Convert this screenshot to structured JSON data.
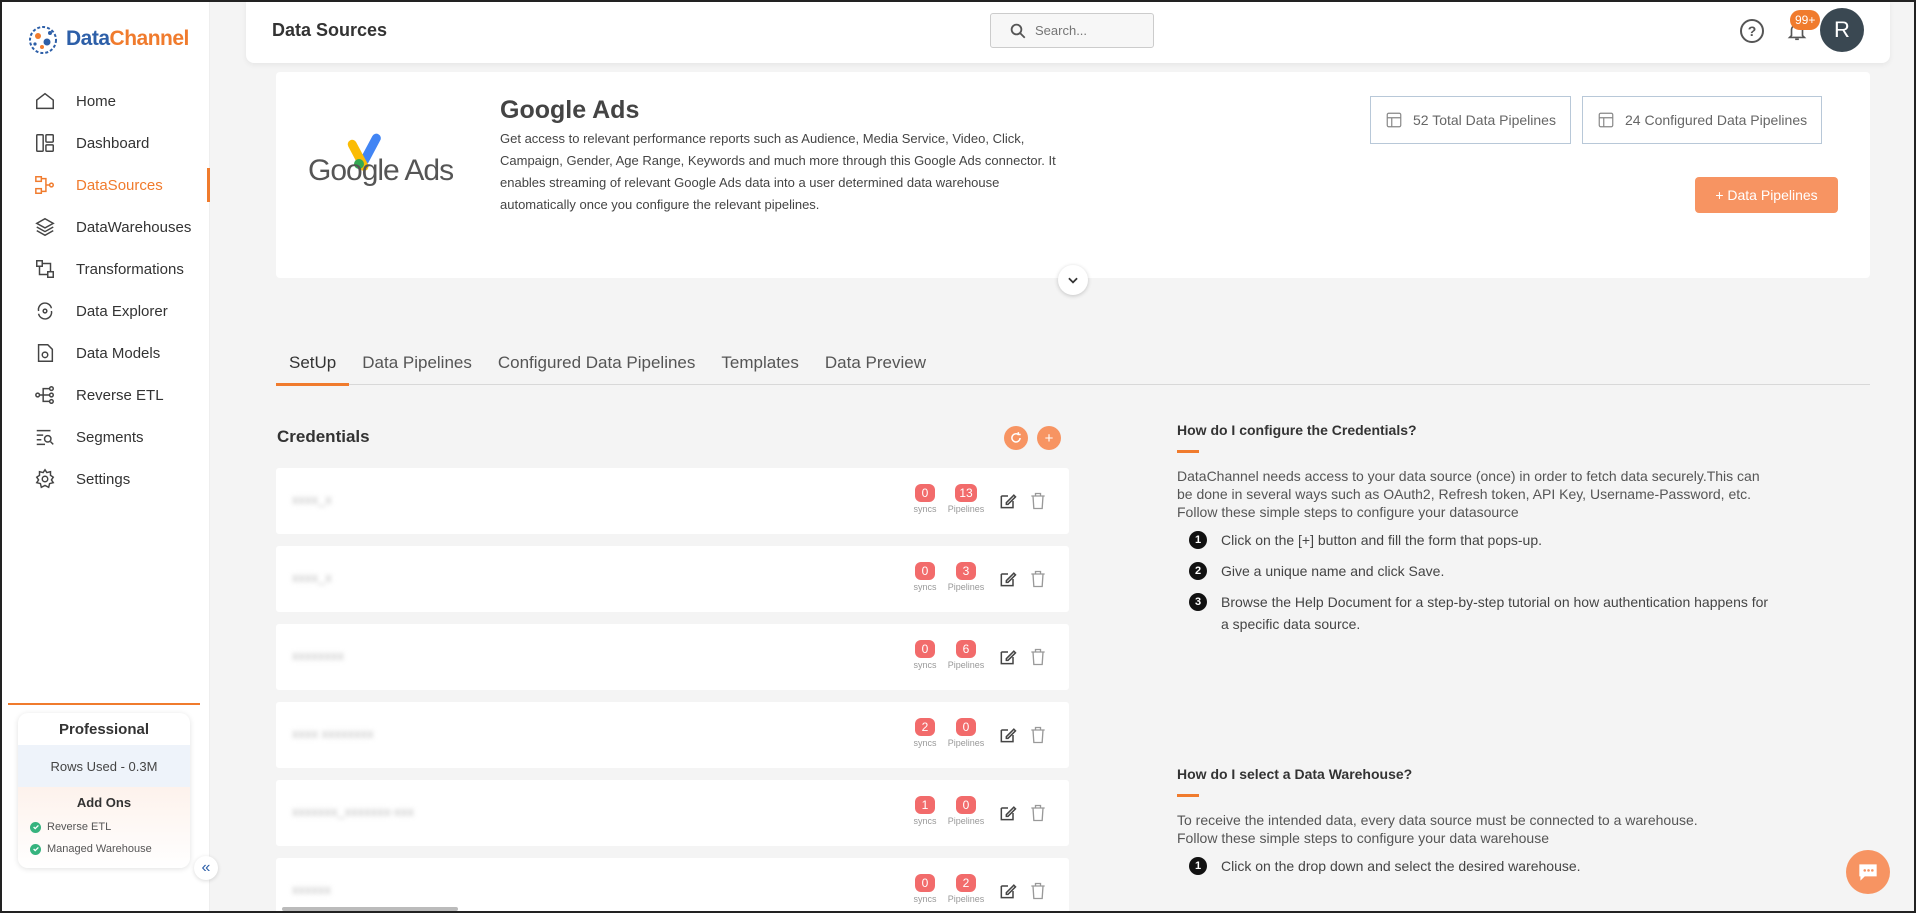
{
  "brand": {
    "name_part1": "Data",
    "name_part2": "Channel"
  },
  "sidebar": {
    "items": [
      {
        "label": "Home",
        "icon": "home-icon"
      },
      {
        "label": "Dashboard",
        "icon": "dashboard-icon"
      },
      {
        "label": "DataSources",
        "icon": "datasources-icon",
        "active": true
      },
      {
        "label": "DataWarehouses",
        "icon": "layers-icon"
      },
      {
        "label": "Transformations",
        "icon": "transform-icon"
      },
      {
        "label": "Data Explorer",
        "icon": "explorer-icon"
      },
      {
        "label": "Data Models",
        "icon": "data-models-icon"
      },
      {
        "label": "Reverse ETL",
        "icon": "reverse-etl-icon"
      },
      {
        "label": "Segments",
        "icon": "segments-icon"
      },
      {
        "label": "Settings",
        "icon": "gear-icon"
      }
    ],
    "plan": {
      "name": "Professional",
      "rows_used": "Rows Used - 0.3M",
      "addons_title": "Add Ons",
      "addons": [
        "Reverse ETL",
        "Managed Warehouse"
      ]
    }
  },
  "header": {
    "title": "Data Sources",
    "search_placeholder": "Search...",
    "notification_count": "99+",
    "avatar_initial": "R"
  },
  "connector": {
    "logo_text": "Google Ads",
    "title": "Google Ads",
    "description": "Get access to relevant performance reports such as Audience, Media Service, Video, Click, Campaign, Gender, Age Range, Keywords and much more through this Google Ads connector. It enables streaming of relevant Google Ads data into a user determined data warehouse automatically once you configure the relevant pipelines.",
    "total_pipelines": "52 Total Data Pipelines",
    "configured_pipelines": "24 Configured Data Pipelines",
    "add_button": "+ Data Pipelines"
  },
  "tabs": [
    "SetUp",
    "Data Pipelines",
    "Configured Data Pipelines",
    "Templates",
    "Data Preview"
  ],
  "credentials": {
    "title": "Credentials",
    "syncs_label": "syncs",
    "pipelines_label": "Pipelines",
    "rows": [
      {
        "name": "xxxx_x",
        "syncs": "0",
        "pipelines": "13"
      },
      {
        "name": "xxxx_x",
        "syncs": "0",
        "pipelines": "3"
      },
      {
        "name": "xxxxxxxx",
        "syncs": "0",
        "pipelines": "6"
      },
      {
        "name": "xxxx xxxxxxxx",
        "syncs": "2",
        "pipelines": "0"
      },
      {
        "name": "xxxxxxx_xxxxxxx-xxx",
        "syncs": "1",
        "pipelines": "0"
      },
      {
        "name": "xxxxxx",
        "syncs": "0",
        "pipelines": "2"
      }
    ]
  },
  "help": {
    "q1": "How do I configure the Credentials?",
    "p1": "DataChannel needs access to your data source (once) in order to fetch data securely.This can be done in several ways such as OAuth2, Refresh token, API Key, Username-Password, etc.",
    "p1b": "Follow these simple steps to configure your datasource",
    "steps1": [
      "Click on the [+] button and fill the form that pops-up.",
      "Give a unique name and click Save.",
      "Browse the Help Document for a step-by-step tutorial on how authentication happens for a specific data source."
    ],
    "q2": "How do I select a Data Warehouse?",
    "p2": "To receive the intended data, every data source must be connected to a warehouse.",
    "p2b": "Follow these simple steps to configure your data warehouse",
    "steps2": [
      "Click on the drop down and select the desired warehouse."
    ]
  },
  "colors": {
    "accent": "#f07b2d",
    "brand_blue": "#2d5fa8",
    "counter_red": "#f26b6b"
  }
}
